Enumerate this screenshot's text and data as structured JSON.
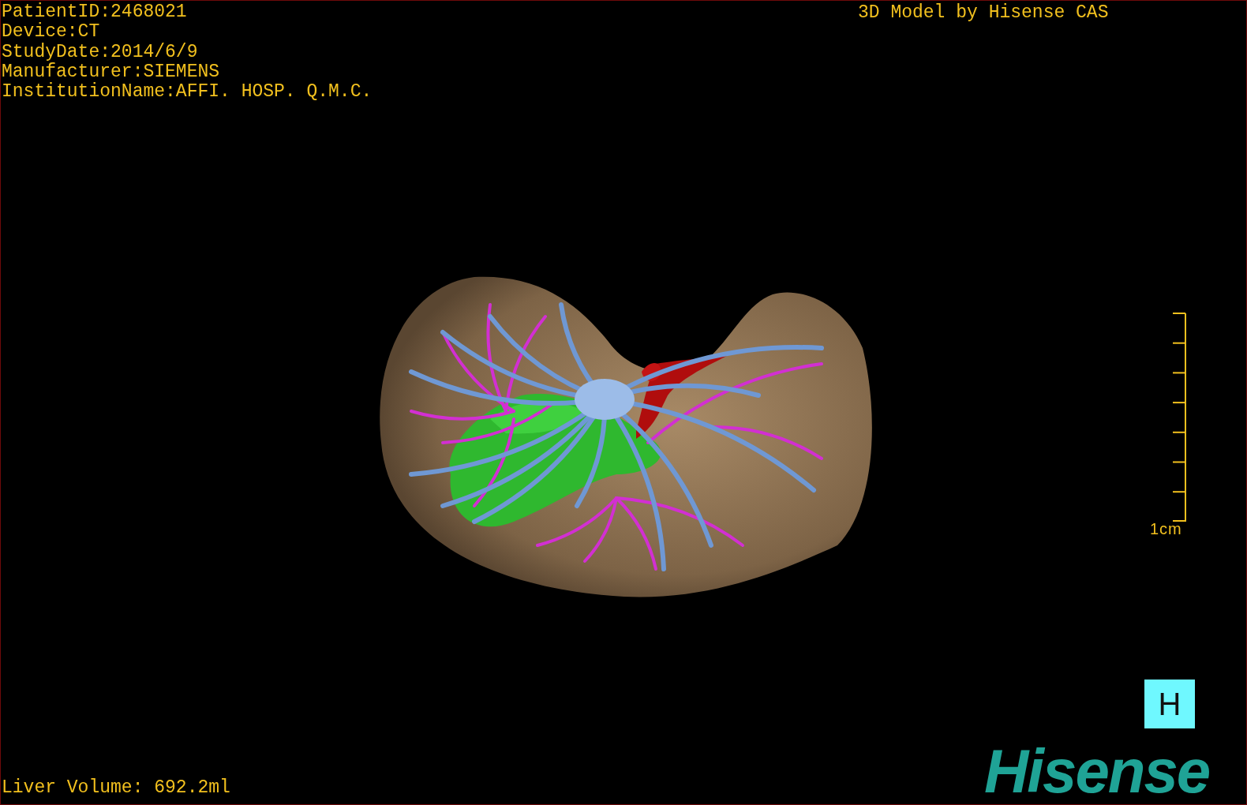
{
  "patient_info": [
    "PatientID:2468021",
    "Device:CT",
    "StudyDate:2014/6/9",
    "Manufacturer:SIEMENS",
    "InstitutionName:AFFI. HOSP. Q.M.C."
  ],
  "model_credit": "3D Model by Hisense CAS",
  "scale_bar": {
    "label": "1cm"
  },
  "orientation_marker": "H",
  "liver_volume": "Liver Volume: 692.2ml",
  "logo": "Hisense"
}
